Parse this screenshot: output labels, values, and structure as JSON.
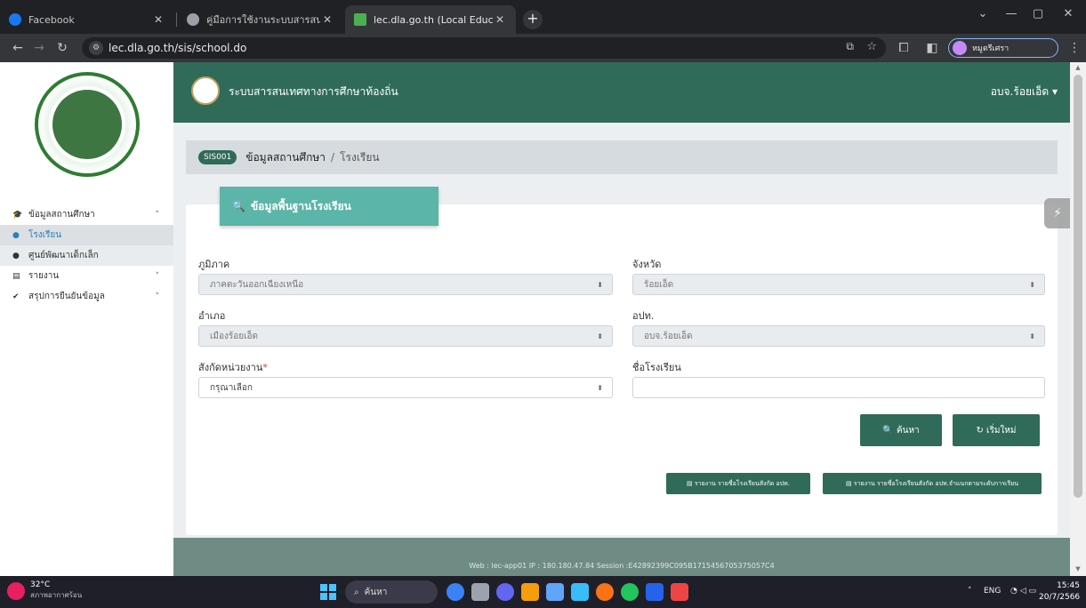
{
  "browser": {
    "tabs": [
      {
        "title": "Facebook",
        "active": false
      },
      {
        "title": "คู่มือการใช้งานระบบสารสนเทศการศึ...",
        "active": false
      },
      {
        "title": "lec.dla.go.th (Local Education C...",
        "active": true
      }
    ],
    "new_tab": "+",
    "url": "lec.dla.go.th/sis/school.do",
    "profile_name": "หมูตรีเศรา"
  },
  "sidebar": {
    "menu": [
      {
        "icon": "graduation-cap-icon",
        "glyph": "🎓",
        "label": "ข้อมูลสถานศึกษา",
        "chev": "˄"
      },
      {
        "icon": "dot-icon",
        "glyph": "●",
        "label": "โรงเรียน"
      },
      {
        "icon": "dot-icon",
        "glyph": "●",
        "label": "ศูนย์พัฒนาเด็กเล็ก"
      },
      {
        "icon": "report-icon",
        "glyph": "▤",
        "label": "รายงาน",
        "chev": "˅"
      },
      {
        "icon": "check-icon",
        "glyph": "✔",
        "label": "สรุปการยืนยันข้อมูล",
        "chev": "˅"
      }
    ]
  },
  "header": {
    "title": "ระบบสารสนเทศทางการศึกษาท้องถิ่น",
    "user": "อบจ.ร้อยเอ็ด ▾"
  },
  "breadcrumb": {
    "badge": "SIS001",
    "main": "ข้อมูลสถานศึกษา",
    "sep": "/",
    "sub": "โรงเรียน"
  },
  "form": {
    "title": "ข้อมูลพื้นฐานโรงเรียน",
    "region_label": "ภูมิภาค",
    "region_value": "ภาคตะวันออกเฉียงเหนือ",
    "province_label": "จังหวัด",
    "province_value": "ร้อยเอ็ด",
    "district_label": "อำเภอ",
    "district_value": "เมืองร้อยเอ็ด",
    "lao_label": "อปท.",
    "lao_value": "อบจ.ร้อยเอ็ด",
    "affiliation_label": "สังกัดหน่วยงาน",
    "required_mark": "*",
    "affiliation_value": "กรุณาเลือก",
    "school_name_label": "ชื่อโรงเรียน",
    "school_name_value": "",
    "search_button": "🔍 ค้นหา",
    "reset_button": "↻ เริ่มใหม่",
    "report1_button": "▤ รายงาน รายชื่อโรงเรียนสังกัด อปท.",
    "report2_button": "▤ รายงาน รายชื่อโรงเรียนสังกัด อปท.จำแนกตามระดับการเรียน"
  },
  "footer": {
    "text": "Web : lec-app01   IP : 180.180.47.84   Session :E42892399C095B1715456705375057C4"
  },
  "taskbar": {
    "temperature": "32°C",
    "weather": "สภาพอากาศร้อน",
    "search": "ค้นหา",
    "lang": "ENG",
    "time": "15:45",
    "date": "20/7/2566"
  }
}
